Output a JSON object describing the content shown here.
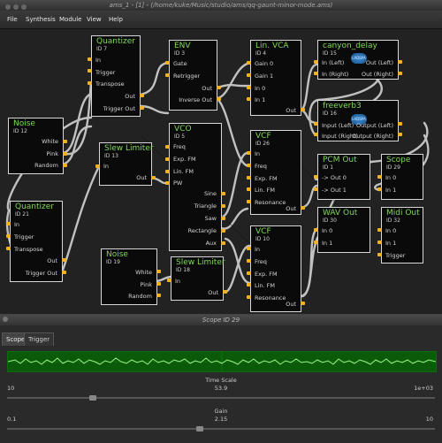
{
  "window": {
    "title": "ams_1 - [1] - (/home/kuke/Music/studio/ams/qq-gaunt-minor-mode.ams)"
  },
  "menu": [
    {
      "label": "File"
    },
    {
      "label": "Synthesis"
    },
    {
      "label": "Module"
    },
    {
      "label": "View"
    },
    {
      "label": "Help"
    }
  ],
  "modules": {
    "quantizer7": {
      "title": "Quantizer",
      "id": "ID 7",
      "in": [
        "In",
        "Trigger",
        "Transpose"
      ],
      "out": [
        "Out",
        "Trigger Out"
      ]
    },
    "env3": {
      "title": "ENV",
      "id": "ID 3",
      "in": [
        "Gate",
        "Retrigger"
      ],
      "out": [
        "Out",
        "Inverse Out"
      ]
    },
    "linvca4": {
      "title": "Lin. VCA",
      "id": "ID 4",
      "in": [
        "Gain 0",
        "Gain 1",
        "In 0",
        "In 1"
      ],
      "out": [
        "Out"
      ]
    },
    "canyon15": {
      "title": "canyon_delay",
      "id": "ID 15",
      "in": [
        "In (Left)",
        "In (Right)"
      ],
      "out": [
        "Out (Left)",
        "Out (Right)"
      ]
    },
    "freeverb16": {
      "title": "freeverb3",
      "id": "ID 16",
      "in": [
        "Input (Left)",
        "Input (Right)"
      ],
      "out": [
        "Output (Left)",
        "Output (Right)"
      ]
    },
    "noise12": {
      "title": "Noise",
      "id": "ID 12",
      "out": [
        "White",
        "Pink",
        "Random"
      ]
    },
    "slew13": {
      "title": "Slew Limiter",
      "id": "ID 13",
      "in": [
        "In"
      ],
      "out": [
        "Out"
      ]
    },
    "vco5": {
      "title": "VCO",
      "id": "ID 5",
      "in": [
        "Freq",
        "Exp. FM",
        "Lin. FM",
        "PW"
      ],
      "out": [
        "Sine",
        "Triangle",
        "Saw",
        "Rectangle",
        "Aux"
      ]
    },
    "vcf26": {
      "title": "VCF",
      "id": "ID 26",
      "in": [
        "In",
        "Freq",
        "Exp. FM",
        "Lin. FM",
        "Resonance"
      ],
      "out": [
        "Out"
      ]
    },
    "pcmout1": {
      "title": "PCM Out",
      "id": "ID 1",
      "in": [
        "-> Out  0",
        "-> Out  1"
      ]
    },
    "scope29": {
      "title": "Scope",
      "id": "ID 29",
      "in": [
        "In 0",
        "In 1"
      ]
    },
    "quantizer21": {
      "title": "Quantizer",
      "id": "ID 21",
      "in": [
        "In",
        "Trigger",
        "Transpose"
      ],
      "out": [
        "Out",
        "Trigger Out"
      ]
    },
    "wavout30": {
      "title": "WAV Out",
      "id": "ID 30",
      "in": [
        "In 0",
        "In 1"
      ]
    },
    "midiout32": {
      "title": "Midi Out",
      "id": "ID 32",
      "in": [
        "In 0",
        "In 1",
        "Trigger"
      ]
    },
    "noise19": {
      "title": "Noise",
      "id": "ID 19",
      "out": [
        "White",
        "Pink",
        "Random"
      ]
    },
    "slew18": {
      "title": "Slew Limiter",
      "id": "ID 18",
      "in": [
        "In"
      ],
      "out": [
        "Out"
      ]
    },
    "vcf10": {
      "title": "VCF",
      "id": "ID 10",
      "in": [
        "In",
        "Freq",
        "Exp. FM",
        "Lin. FM",
        "Resonance"
      ],
      "out": [
        "Out"
      ]
    }
  },
  "ladspa_logo": "LADSPA",
  "scope_window": {
    "title": "Scope ID 29",
    "tabs": [
      "Scope",
      "Trigger"
    ],
    "active_tab": "Scope",
    "time_scale": {
      "label": "Time Scale",
      "value": "53.9",
      "min": "10",
      "max": "1e+03",
      "fraction": 0.2
    },
    "gain": {
      "label": "Gain",
      "value": "2.15",
      "min": "0.1",
      "max": "10",
      "fraction": 0.45
    }
  },
  "colors": {
    "accent_title": "#7ed957",
    "jack": "#f5b21f",
    "scope_bg": "#0a5a0a",
    "trace": "#9ef08a"
  }
}
